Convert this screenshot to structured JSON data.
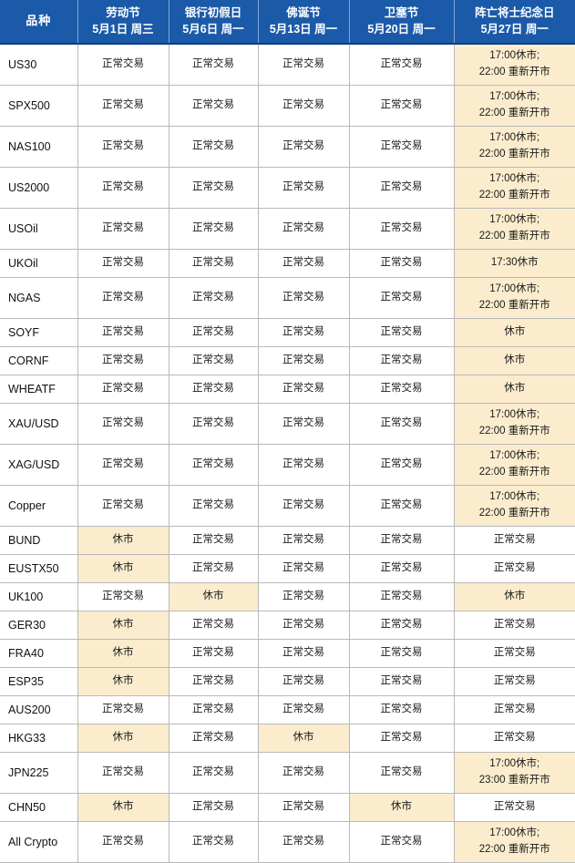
{
  "table": {
    "columns": [
      {
        "id": "symbol",
        "label": "品种",
        "date": ""
      },
      {
        "id": "labour_day",
        "label": "劳动节",
        "date": "5月1日 周三"
      },
      {
        "id": "bank_holiday",
        "label": "银行初假日",
        "date": "5月6日 周一"
      },
      {
        "id": "buddha_day",
        "label": "佛诞节",
        "date": "5月13日 周一"
      },
      {
        "id": "vesak_day",
        "label": "卫塞节",
        "date": "5月20日 周一"
      },
      {
        "id": "memorial_day",
        "label": "阵亡将士纪念日",
        "date": "5月27日 周一"
      }
    ],
    "status_texts": {
      "normal": "正常交易",
      "closed": "休市",
      "close_1700_reopen_2200_line1": "17:00休市;",
      "close_1700_reopen_2200_line2": "22:00 重新开市",
      "close_1700_reopen_2300_line1": "17:00休市;",
      "close_1700_reopen_2300_line2": "23:00 重新开市",
      "close_1730": "17:30休市"
    },
    "colors": {
      "header_blue": "#1b5aa8",
      "header_text": "#ffffff",
      "highlight": "#fbeccd",
      "border": "#b9b9b9",
      "cell_text": "#1a1a1a"
    },
    "rows": [
      {
        "symbol": "US30",
        "height": "tall",
        "cells": [
          {
            "text": "正常交易",
            "hi": false
          },
          {
            "text": "正常交易",
            "hi": false
          },
          {
            "text": "正常交易",
            "hi": false
          },
          {
            "text": "正常交易",
            "hi": false
          },
          {
            "lines": [
              "17:00休市;",
              "22:00 重新开市"
            ],
            "hi": true
          }
        ]
      },
      {
        "symbol": "SPX500",
        "height": "tall",
        "cells": [
          {
            "text": "正常交易",
            "hi": false
          },
          {
            "text": "正常交易",
            "hi": false
          },
          {
            "text": "正常交易",
            "hi": false
          },
          {
            "text": "正常交易",
            "hi": false
          },
          {
            "lines": [
              "17:00休市;",
              "22:00 重新开市"
            ],
            "hi": true
          }
        ]
      },
      {
        "symbol": "NAS100",
        "height": "tall",
        "cells": [
          {
            "text": "正常交易",
            "hi": false
          },
          {
            "text": "正常交易",
            "hi": false
          },
          {
            "text": "正常交易",
            "hi": false
          },
          {
            "text": "正常交易",
            "hi": false
          },
          {
            "lines": [
              "17:00休市;",
              "22:00 重新开市"
            ],
            "hi": true
          }
        ]
      },
      {
        "symbol": "US2000",
        "height": "tall",
        "cells": [
          {
            "text": "正常交易",
            "hi": false
          },
          {
            "text": "正常交易",
            "hi": false
          },
          {
            "text": "正常交易",
            "hi": false
          },
          {
            "text": "正常交易",
            "hi": false
          },
          {
            "lines": [
              "17:00休市;",
              "22:00 重新开市"
            ],
            "hi": true
          }
        ]
      },
      {
        "symbol": "USOil",
        "height": "tall",
        "cells": [
          {
            "text": "正常交易",
            "hi": false
          },
          {
            "text": "正常交易",
            "hi": false
          },
          {
            "text": "正常交易",
            "hi": false
          },
          {
            "text": "正常交易",
            "hi": false
          },
          {
            "lines": [
              "17:00休市;",
              "22:00 重新开市"
            ],
            "hi": true
          }
        ]
      },
      {
        "symbol": "UKOil",
        "height": "short",
        "cells": [
          {
            "text": "正常交易",
            "hi": false
          },
          {
            "text": "正常交易",
            "hi": false
          },
          {
            "text": "正常交易",
            "hi": false
          },
          {
            "text": "正常交易",
            "hi": false
          },
          {
            "text": "17:30休市",
            "hi": true
          }
        ]
      },
      {
        "symbol": "NGAS",
        "height": "tall",
        "cells": [
          {
            "text": "正常交易",
            "hi": false
          },
          {
            "text": "正常交易",
            "hi": false
          },
          {
            "text": "正常交易",
            "hi": false
          },
          {
            "text": "正常交易",
            "hi": false
          },
          {
            "lines": [
              "17:00休市;",
              "22:00 重新开市"
            ],
            "hi": true
          }
        ]
      },
      {
        "symbol": "SOYF",
        "height": "short",
        "cells": [
          {
            "text": "正常交易",
            "hi": false
          },
          {
            "text": "正常交易",
            "hi": false
          },
          {
            "text": "正常交易",
            "hi": false
          },
          {
            "text": "正常交易",
            "hi": false
          },
          {
            "text": "休市",
            "hi": true
          }
        ]
      },
      {
        "symbol": "CORNF",
        "height": "short",
        "cells": [
          {
            "text": "正常交易",
            "hi": false
          },
          {
            "text": "正常交易",
            "hi": false
          },
          {
            "text": "正常交易",
            "hi": false
          },
          {
            "text": "正常交易",
            "hi": false
          },
          {
            "text": "休市",
            "hi": true
          }
        ]
      },
      {
        "symbol": "WHEATF",
        "height": "short",
        "cells": [
          {
            "text": "正常交易",
            "hi": false
          },
          {
            "text": "正常交易",
            "hi": false
          },
          {
            "text": "正常交易",
            "hi": false
          },
          {
            "text": "正常交易",
            "hi": false
          },
          {
            "text": "休市",
            "hi": true
          }
        ]
      },
      {
        "symbol": "XAU/USD",
        "height": "tall",
        "cells": [
          {
            "text": "正常交易",
            "hi": false
          },
          {
            "text": "正常交易",
            "hi": false
          },
          {
            "text": "正常交易",
            "hi": false
          },
          {
            "text": "正常交易",
            "hi": false
          },
          {
            "lines": [
              "17:00休市;",
              "22:00 重新开市"
            ],
            "hi": true
          }
        ]
      },
      {
        "symbol": "XAG/USD",
        "height": "tall",
        "cells": [
          {
            "text": "正常交易",
            "hi": false
          },
          {
            "text": "正常交易",
            "hi": false
          },
          {
            "text": "正常交易",
            "hi": false
          },
          {
            "text": "正常交易",
            "hi": false
          },
          {
            "lines": [
              "17:00休市;",
              "22:00 重新开市"
            ],
            "hi": true
          }
        ]
      },
      {
        "symbol": "Copper",
        "height": "tall",
        "cells": [
          {
            "text": "正常交易",
            "hi": false
          },
          {
            "text": "正常交易",
            "hi": false
          },
          {
            "text": "正常交易",
            "hi": false
          },
          {
            "text": "正常交易",
            "hi": false
          },
          {
            "lines": [
              "17:00休市;",
              "22:00 重新开市"
            ],
            "hi": true
          }
        ]
      },
      {
        "symbol": "BUND",
        "height": "short",
        "cells": [
          {
            "text": "休市",
            "hi": true
          },
          {
            "text": "正常交易",
            "hi": false
          },
          {
            "text": "正常交易",
            "hi": false
          },
          {
            "text": "正常交易",
            "hi": false
          },
          {
            "text": "正常交易",
            "hi": false
          }
        ]
      },
      {
        "symbol": "EUSTX50",
        "height": "short",
        "cells": [
          {
            "text": "休市",
            "hi": true
          },
          {
            "text": "正常交易",
            "hi": false
          },
          {
            "text": "正常交易",
            "hi": false
          },
          {
            "text": "正常交易",
            "hi": false
          },
          {
            "text": "正常交易",
            "hi": false
          }
        ]
      },
      {
        "symbol": "UK100",
        "height": "short",
        "cells": [
          {
            "text": "正常交易",
            "hi": false
          },
          {
            "text": "休市",
            "hi": true
          },
          {
            "text": "正常交易",
            "hi": false
          },
          {
            "text": "正常交易",
            "hi": false
          },
          {
            "text": "休市",
            "hi": true
          }
        ]
      },
      {
        "symbol": "GER30",
        "height": "short",
        "cells": [
          {
            "text": "休市",
            "hi": true
          },
          {
            "text": "正常交易",
            "hi": false
          },
          {
            "text": "正常交易",
            "hi": false
          },
          {
            "text": "正常交易",
            "hi": false
          },
          {
            "text": "正常交易",
            "hi": false
          }
        ]
      },
      {
        "symbol": "FRA40",
        "height": "short",
        "cells": [
          {
            "text": "休市",
            "hi": true
          },
          {
            "text": "正常交易",
            "hi": false
          },
          {
            "text": "正常交易",
            "hi": false
          },
          {
            "text": "正常交易",
            "hi": false
          },
          {
            "text": "正常交易",
            "hi": false
          }
        ]
      },
      {
        "symbol": "ESP35",
        "height": "short",
        "cells": [
          {
            "text": "休市",
            "hi": true
          },
          {
            "text": "正常交易",
            "hi": false
          },
          {
            "text": "正常交易",
            "hi": false
          },
          {
            "text": "正常交易",
            "hi": false
          },
          {
            "text": "正常交易",
            "hi": false
          }
        ]
      },
      {
        "symbol": "AUS200",
        "height": "short",
        "cells": [
          {
            "text": "正常交易",
            "hi": false
          },
          {
            "text": "正常交易",
            "hi": false
          },
          {
            "text": "正常交易",
            "hi": false
          },
          {
            "text": "正常交易",
            "hi": false
          },
          {
            "text": "正常交易",
            "hi": false
          }
        ]
      },
      {
        "symbol": "HKG33",
        "height": "short",
        "cells": [
          {
            "text": "休市",
            "hi": true
          },
          {
            "text": "正常交易",
            "hi": false
          },
          {
            "text": "休市",
            "hi": true
          },
          {
            "text": "正常交易",
            "hi": false
          },
          {
            "text": "正常交易",
            "hi": false
          }
        ]
      },
      {
        "symbol": "JPN225",
        "height": "tall",
        "cells": [
          {
            "text": "正常交易",
            "hi": false
          },
          {
            "text": "正常交易",
            "hi": false
          },
          {
            "text": "正常交易",
            "hi": false
          },
          {
            "text": "正常交易",
            "hi": false
          },
          {
            "lines": [
              "17:00休市;",
              "23:00 重新开市"
            ],
            "hi": true
          }
        ]
      },
      {
        "symbol": "CHN50",
        "height": "short",
        "cells": [
          {
            "text": "休市",
            "hi": true
          },
          {
            "text": "正常交易",
            "hi": false
          },
          {
            "text": "正常交易",
            "hi": false
          },
          {
            "text": "休市",
            "hi": true
          },
          {
            "text": "正常交易",
            "hi": false
          }
        ]
      },
      {
        "symbol": "All Crypto",
        "height": "tall",
        "cells": [
          {
            "text": "正常交易",
            "hi": false
          },
          {
            "text": "正常交易",
            "hi": false
          },
          {
            "text": "正常交易",
            "hi": false
          },
          {
            "text": "正常交易",
            "hi": false
          },
          {
            "lines": [
              "17:00休市;",
              "22:00 重新开市"
            ],
            "hi": true
          }
        ]
      }
    ]
  }
}
